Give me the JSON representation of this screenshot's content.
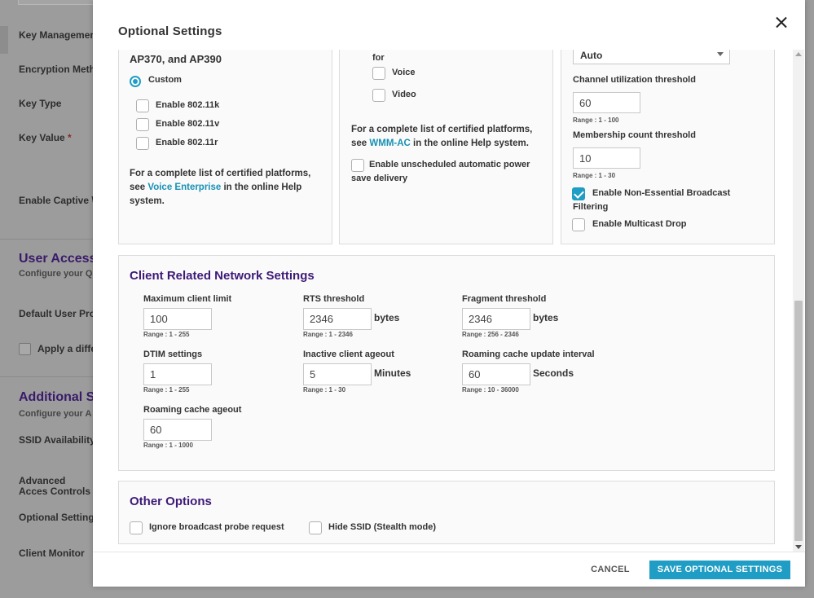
{
  "background": {
    "labels": [
      "Key Management",
      "Encryption Metho",
      "Key Type",
      "Key Value",
      "Enable Captive \\",
      "Default User Pro",
      "SSID Availability S",
      "Advanced Acces Controls",
      "Optional Setting",
      "Client Monitor"
    ],
    "key_value_required": "*",
    "section_user_access": "User Access",
    "section_user_access_sub": "Configure your Q",
    "apply_label": "Apply a diffe",
    "section_additional": "Additional S",
    "section_additional_sub": "Configure your A"
  },
  "modal": {
    "title": "Optional Settings",
    "close_icon": "close-icon",
    "col1": {
      "heading_tail": "AP370, and AP390",
      "radio_label": "Custom",
      "options": [
        {
          "label": "Enable 802.11k",
          "checked": false
        },
        {
          "label": "Enable 802.11v",
          "checked": false
        },
        {
          "label": "Enable 802.11r",
          "checked": false
        }
      ],
      "note_pre": "For a complete list of certified platforms, see ",
      "note_link": "Voice Enterprise",
      "note_post": " in the online Help system."
    },
    "col2": {
      "heading_tail": "for",
      "options": [
        {
          "label": "Voice",
          "checked": false
        },
        {
          "label": "Video",
          "checked": false
        }
      ],
      "note_pre": "For a complete list of certified platforms, see ",
      "note_link": "WMM-AC",
      "note_post": " in the online Help system.",
      "power_save_label": "Enable unscheduled automatic power save delivery"
    },
    "col3": {
      "select_value": "Auto",
      "channel_util_label": "Channel utilization threshold",
      "channel_util_value": "60",
      "channel_util_range": "Range : 1 - 100",
      "membership_label": "Membership count threshold",
      "membership_value": "10",
      "membership_range": "Range : 1 - 30",
      "broadcast_filter_label": "Enable Non-Essential Broadcast Filtering",
      "broadcast_filter_checked": true,
      "multicast_drop_label": "Enable Multicast Drop",
      "multicast_drop_checked": false
    },
    "client_section": {
      "title": "Client Related Network Settings",
      "max_client": {
        "label": "Maximum client limit",
        "value": "100",
        "range": "Range : 1 - 255"
      },
      "rts": {
        "label": "RTS threshold",
        "value": "2346",
        "unit": "bytes",
        "range": "Range : 1 - 2346"
      },
      "fragment": {
        "label": "Fragment threshold",
        "value": "2346",
        "unit": "bytes",
        "range": "Range : 256 - 2346"
      },
      "dtim": {
        "label": "DTIM settings",
        "value": "1",
        "range": "Range : 1 - 255"
      },
      "inactive": {
        "label": "Inactive client ageout",
        "value": "5",
        "unit": "Minutes",
        "range": "Range : 1 - 30"
      },
      "roaming_update": {
        "label": "Roaming cache update interval",
        "value": "60",
        "unit": "Seconds",
        "range": "Range : 10 - 36000"
      },
      "roaming_ageout": {
        "label": "Roaming cache ageout",
        "value": "60",
        "range": "Range : 1 - 1000"
      }
    },
    "other_section": {
      "title": "Other Options",
      "ignore_probe_label": "Ignore broadcast probe request",
      "hide_ssid_label": "Hide SSID (Stealth mode)"
    },
    "footer": {
      "cancel_label": "CANCEL",
      "save_label": "SAVE OPTIONAL SETTINGS"
    }
  },
  "colors": {
    "accent": "#1f9dc4",
    "section_title": "#3d1a78",
    "link": "#1891b4"
  }
}
